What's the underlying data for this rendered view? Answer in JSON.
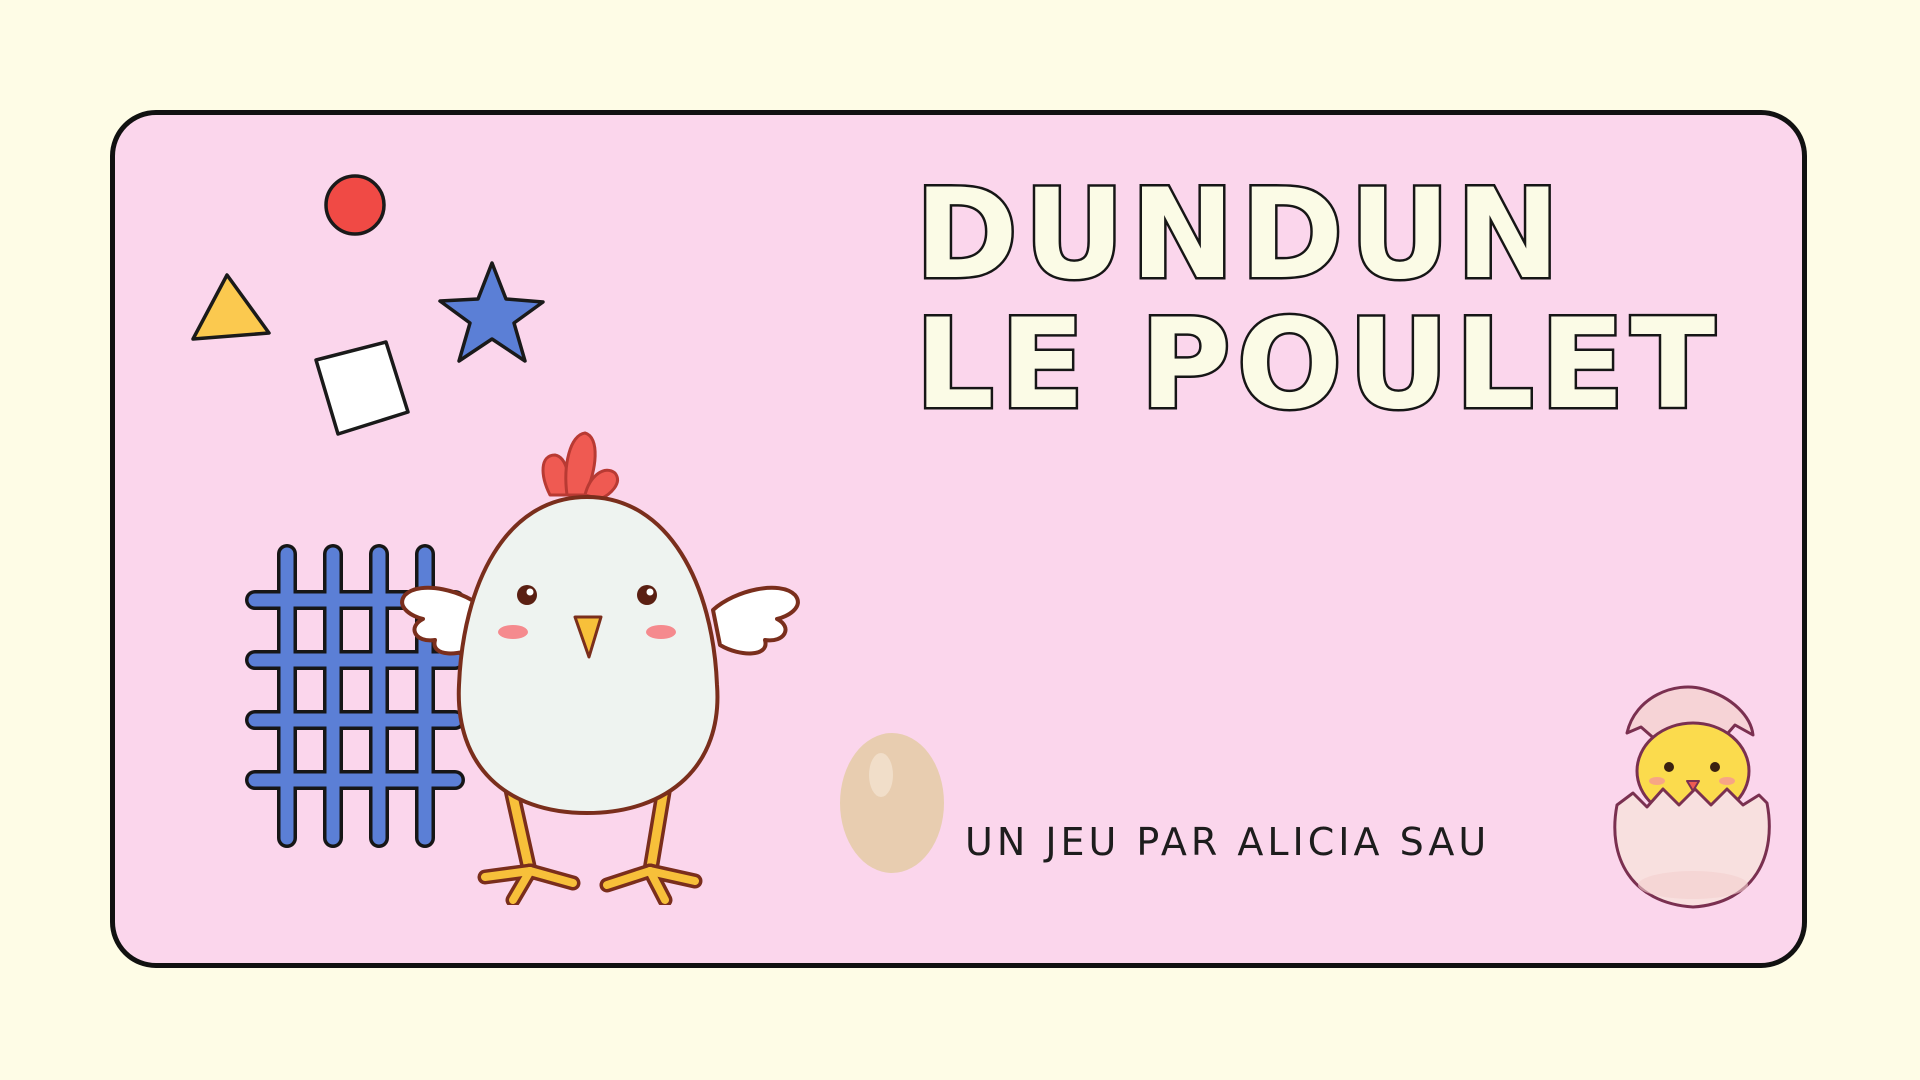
{
  "title": {
    "line1": "DUNDUN",
    "line2": "LE POULET"
  },
  "byline": "UN JEU PAR ALICIA SAU",
  "colors": {
    "page_background": "#fefce6",
    "card_background": "#fbd6ec",
    "title_fill": "#fbfbe6",
    "title_outline": "#161616",
    "circle": "#f04a45",
    "triangle": "#fbc94f",
    "star": "#5b7fd6",
    "grid": "#5b7fd6",
    "chicken_body": "#eef3f0",
    "chicken_comb": "#ef5a52",
    "chicken_feet": "#f7c03a",
    "egg": "#e8cdb0",
    "eggshell": "#f8dedd",
    "chick": "#fbdb4d"
  },
  "icons": [
    "red-circle-icon",
    "yellow-triangle-icon",
    "blue-star-icon",
    "white-square-icon",
    "blue-grid-icon",
    "chicken-icon",
    "egg-icon",
    "hatching-chick-icon"
  ]
}
